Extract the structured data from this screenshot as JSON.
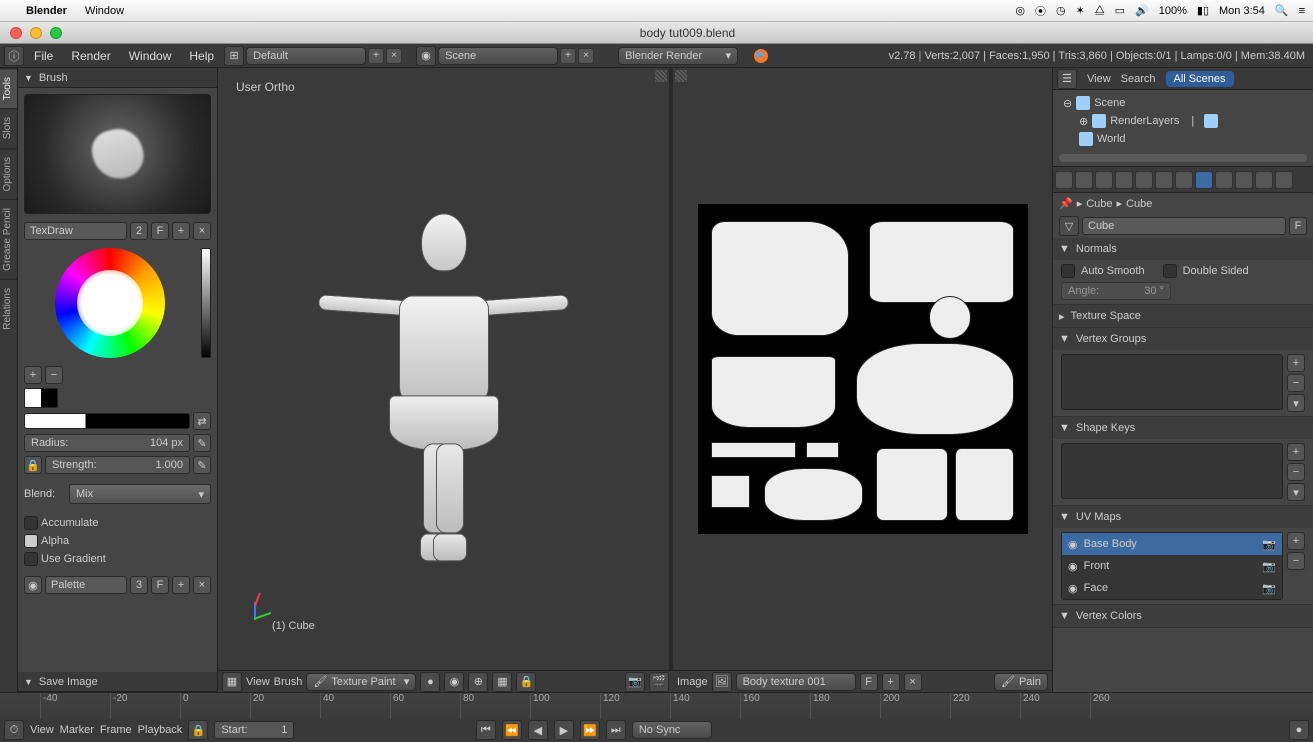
{
  "macos": {
    "app": "Blender",
    "menu_window": "Window",
    "battery": "100%",
    "clock": "Mon 3:54"
  },
  "window": {
    "title": "body tut009.blend"
  },
  "info": {
    "menu_file": "File",
    "menu_render": "Render",
    "menu_window": "Window",
    "menu_help": "Help",
    "layout_preset": "Default",
    "scene": "Scene",
    "engine": "Blender Render",
    "version": "v2.78",
    "stats": "Verts:2,007 | Faces:1,950 | Tris:3,860 | Objects:0/1 | Lamps:0/0 | Mem:38.40M"
  },
  "side_tabs": [
    "Tools",
    "Slots",
    "Options",
    "Grease Pencil",
    "Relations"
  ],
  "brush": {
    "panel_title": "Brush",
    "name": "TexDraw",
    "users": "2",
    "fake": "F",
    "radius_label": "Radius:",
    "radius_value": "104 px",
    "strength_label": "Strength:",
    "strength_value": "1.000",
    "blend_label": "Blend:",
    "blend_value": "Mix",
    "accumulate": "Accumulate",
    "alpha": "Alpha",
    "use_gradient": "Use Gradient",
    "palette": "Palette",
    "palette_users": "3",
    "save_image": "Save Image"
  },
  "viewport": {
    "projection": "User Ortho",
    "object": "(1) Cube",
    "menu_view": "View",
    "menu_brush": "Brush",
    "mode": "Texture Paint"
  },
  "uv": {
    "menu_image": "Image",
    "texture_name": "Body texture 001",
    "fake": "F",
    "paint_label": "Pain"
  },
  "outliner": {
    "menu_view": "View",
    "menu_search": "Search",
    "filter": "All Scenes",
    "scene": "Scene",
    "renderlayers": "RenderLayers",
    "world": "World"
  },
  "props": {
    "crumb1": "Cube",
    "crumb2": "Cube",
    "datablock": "Cube",
    "fake": "F",
    "normals": "Normals",
    "auto_smooth": "Auto Smooth",
    "double_sided": "Double Sided",
    "angle_label": "Angle:",
    "angle_value": "30 °",
    "texture_space": "Texture Space",
    "vertex_groups": "Vertex Groups",
    "shape_keys": "Shape Keys",
    "uv_maps": "UV Maps",
    "uv1": "Base Body",
    "uv2": "Front",
    "uv3": "Face",
    "vertex_colors": "Vertex Colors"
  },
  "timeline": {
    "menu_view": "View",
    "menu_marker": "Marker",
    "menu_frame": "Frame",
    "menu_playback": "Playback",
    "start_label": "Start:",
    "start_value": "1",
    "nosync": "No Sync",
    "ticks": [
      "-40",
      "-20",
      "0",
      "20",
      "40",
      "60",
      "80",
      "100",
      "120",
      "140",
      "160",
      "180",
      "200",
      "220",
      "240",
      "260"
    ]
  }
}
